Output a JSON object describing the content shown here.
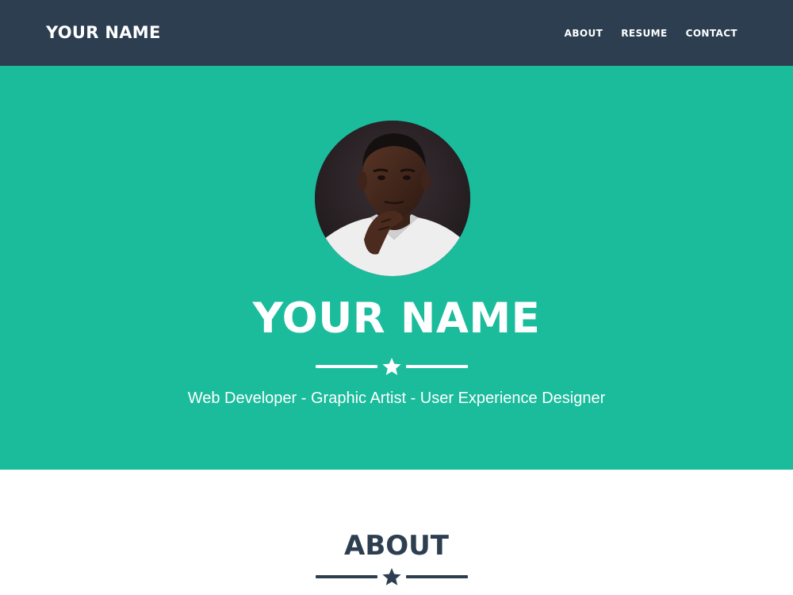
{
  "navbar": {
    "brand": "YOUR NAME",
    "links": [
      "ABOUT",
      "RESUME",
      "CONTACT"
    ]
  },
  "hero": {
    "title": "YOUR NAME",
    "subtitle": "Web Developer - Graphic Artist - User Experience Designer",
    "divider_icon": "star-icon"
  },
  "about": {
    "title": "ABOUT",
    "divider_icon": "star-icon"
  },
  "colors": {
    "navbar_bg": "#2c3e50",
    "hero_bg": "#1abc9c",
    "text_light": "#ffffff",
    "text_dark": "#2c3e50"
  }
}
